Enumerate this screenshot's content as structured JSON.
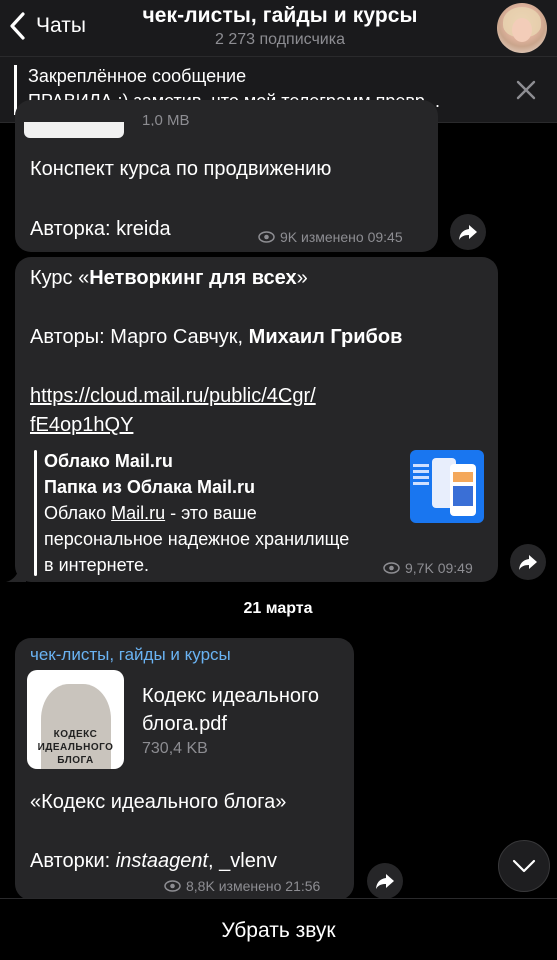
{
  "header": {
    "back_label": "Чаты",
    "title": "чек-листы, гайды и курсы",
    "subtitle": "2 273 подписчика"
  },
  "pinned": {
    "title": "Закреплённое сообщение",
    "text": "ПРАВИЛА :) заметив, что мой телеграмм превр..."
  },
  "messages": [
    {
      "file_size_partial": "1,0 MB",
      "line1": "Конспект курса по продвижению",
      "line2": "Авторка: kreida",
      "views": "9K",
      "edited": "изменено",
      "time": "09:45"
    },
    {
      "course_prefix": "Курс «",
      "course_name": "Нетворкинг для всех",
      "course_suffix": "»",
      "authors_prefix": "Авторы: Марго Савчук, ",
      "authors_bold": "Михаил Грибов",
      "link_line1": "https://cloud.mail.ru/public/4Cgr/",
      "link_line2": "fE4op1hQY",
      "preview": {
        "site": "Облако Mail.ru",
        "title": "Папка из Облака Mail.ru",
        "desc_prefix": "Облако ",
        "desc_link": "Mail.ru",
        "desc_suffix": " - это ваше",
        "desc_line2": "персональное надежное хранилище",
        "desc_line3": "в интернете."
      },
      "views": "9,7K",
      "time": "09:49"
    },
    {
      "channel": "чек-листы, гайды и курсы",
      "file_name_line1": "Кодекс идеального",
      "file_name_line2": "блога.pdf",
      "file_size": "730,4 KB",
      "thumb_caption": "КОДЕКС ИДЕАЛЬНОГО БЛОГА",
      "line1": "«Кодекс идеального блога»",
      "authors_prefix": "Авторки: ",
      "authors_italic": "instaagent",
      "authors_suffix": ", _vlenv",
      "views": "8,8K",
      "edited": "изменено",
      "time": "21:56"
    }
  ],
  "date_separator": "21 марта",
  "bottom_action": "Убрать звук",
  "colors": {
    "background": "#000000",
    "bubble": "#262628",
    "header": "#1a1a1c",
    "channel_name": "#6ab3f3",
    "meta": "#8d8d92"
  }
}
